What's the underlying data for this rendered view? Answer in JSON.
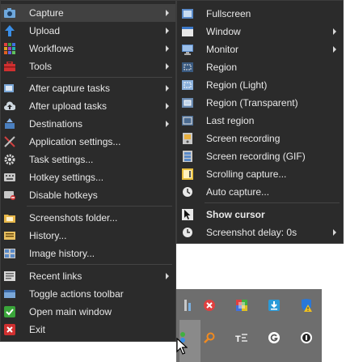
{
  "main_menu": {
    "items": [
      {
        "label": "Capture",
        "icon": "camera-icon",
        "has_submenu": true,
        "highlighted": true
      },
      {
        "label": "Upload",
        "icon": "upload-arrow-icon",
        "has_submenu": true
      },
      {
        "label": "Workflows",
        "icon": "workflows-grid-icon",
        "has_submenu": true
      },
      {
        "label": "Tools",
        "icon": "toolbox-icon",
        "has_submenu": true
      },
      {
        "label": "After capture tasks",
        "icon": "after-capture-icon",
        "has_submenu": true
      },
      {
        "label": "After upload tasks",
        "icon": "cloud-upload-icon",
        "has_submenu": true
      },
      {
        "label": "Destinations",
        "icon": "destinations-icon",
        "has_submenu": true
      },
      {
        "label": "Application settings...",
        "icon": "wrench-screwdriver-icon"
      },
      {
        "label": "Task settings...",
        "icon": "gear-icon"
      },
      {
        "label": "Hotkey settings...",
        "icon": "keyboard-icon"
      },
      {
        "label": "Disable hotkeys",
        "icon": "disable-hotkeys-icon"
      },
      {
        "label": "Screenshots folder...",
        "icon": "folder-icon"
      },
      {
        "label": "History...",
        "icon": "history-icon"
      },
      {
        "label": "Image history...",
        "icon": "image-history-icon"
      },
      {
        "label": "Recent links",
        "icon": "recent-links-icon",
        "has_submenu": true
      },
      {
        "label": "Toggle actions toolbar",
        "icon": "toolbar-icon"
      },
      {
        "label": "Open main window",
        "icon": "check-icon"
      },
      {
        "label": "Exit",
        "icon": "exit-x-icon"
      }
    ]
  },
  "capture_submenu": {
    "items": [
      {
        "label": "Fullscreen",
        "icon": "fullscreen-icon"
      },
      {
        "label": "Window",
        "icon": "window-icon",
        "has_submenu": true
      },
      {
        "label": "Monitor",
        "icon": "monitor-icon",
        "has_submenu": true
      },
      {
        "label": "Region",
        "icon": "region-icon"
      },
      {
        "label": "Region (Light)",
        "icon": "region-light-icon"
      },
      {
        "label": "Region (Transparent)",
        "icon": "region-transparent-icon"
      },
      {
        "label": "Last region",
        "icon": "last-region-icon"
      },
      {
        "label": "Screen recording",
        "icon": "screen-recording-icon"
      },
      {
        "label": "Screen recording (GIF)",
        "icon": "gif-recording-icon"
      },
      {
        "label": "Scrolling capture...",
        "icon": "scrolling-capture-icon"
      },
      {
        "label": "Auto capture...",
        "icon": "clock-icon"
      },
      {
        "label": "Show cursor",
        "icon": "cursor-icon",
        "bold": true
      },
      {
        "label": "Screenshot delay: 0s",
        "icon": "delay-clock-icon",
        "has_submenu": true
      }
    ]
  },
  "tray": {
    "icons": [
      "tray-app-icon",
      "red-x-icon",
      "color-palette-icon",
      "download-shield-icon",
      "security-warning-icon",
      "sharex-icon",
      "search-icon",
      "ocr-icon",
      "refresh-g-icon",
      "info-circle-icon"
    ]
  },
  "colors": {
    "menu_bg": "#2b2b2b",
    "highlight": "#414141",
    "text": "#e8e8e8",
    "tray_bg": "#6e6e6e"
  }
}
